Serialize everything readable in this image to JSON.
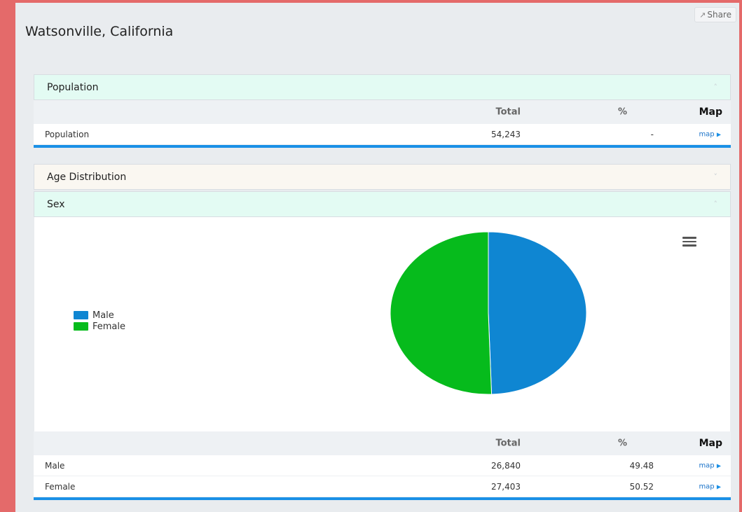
{
  "share_label": "Share",
  "page_title": "Watsonville, California",
  "population_section": {
    "title": "Population",
    "columns": [
      "Total",
      "%",
      "Map"
    ],
    "rows": [
      {
        "name": "Population",
        "total": "54,243",
        "pct": "-",
        "map": "map"
      }
    ]
  },
  "age_section": {
    "title": "Age Distribution"
  },
  "sex_section": {
    "title": "Sex",
    "columns": [
      "Total",
      "%",
      "Map"
    ],
    "rows": [
      {
        "name": "Male",
        "total": "26,840",
        "pct": "49.48",
        "map": "map"
      },
      {
        "name": "Female",
        "total": "27,403",
        "pct": "50.52",
        "map": "map"
      }
    ]
  },
  "icons": {
    "share": "share-icon",
    "menu": "hamburger-menu-icon",
    "expand": "chevron-icon",
    "map_arrow": "triangle-right-icon"
  },
  "colors": {
    "male": "#0f86d2",
    "female": "#06bb1c",
    "accent_line": "#1a90e6",
    "header_mint": "#e3fbf3"
  },
  "chart_data": {
    "type": "pie",
    "labels": [
      "Male",
      "Female"
    ],
    "values": [
      49.48,
      50.52
    ],
    "colors": [
      "#0f86d2",
      "#06bb1c"
    ],
    "legend": "left"
  }
}
